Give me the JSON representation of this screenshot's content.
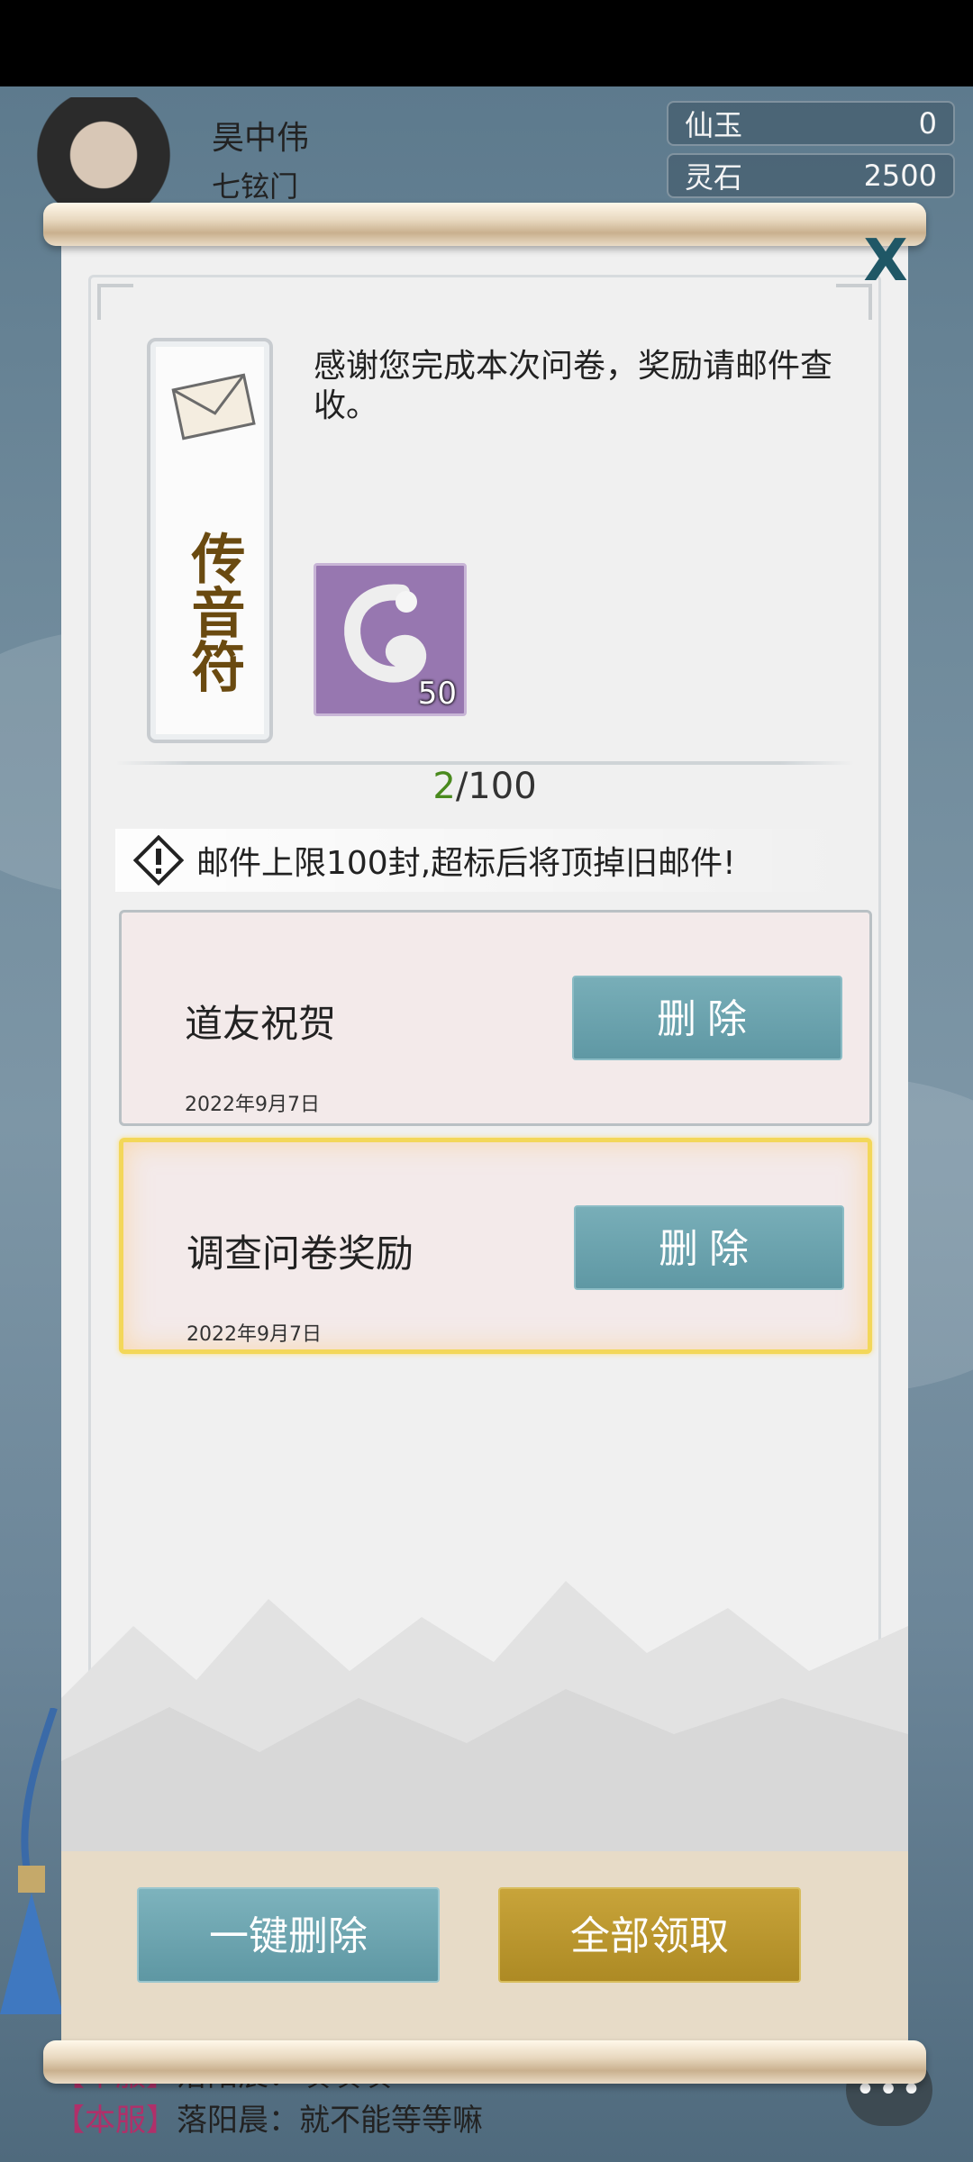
{
  "hud": {
    "player_name": "昊中伟",
    "sect": "七铉门",
    "resources": [
      {
        "label": "仙玉",
        "value": "0"
      },
      {
        "label": "灵石",
        "value": "2500"
      }
    ]
  },
  "dialog": {
    "close_label": "X",
    "talisman_title": "传音符",
    "message": "感谢您完成本次问卷，奖励请邮件查收。",
    "reward": {
      "count": "50",
      "icon": "silver-dragon-item-icon"
    },
    "mail_count": {
      "current": "2",
      "max": "/100"
    },
    "warning": "邮件上限100封,超标后将顶掉旧邮件!",
    "mails": [
      {
        "title": "道友祝贺",
        "date": "2022年9月7日",
        "delete_label": "删除",
        "selected": false
      },
      {
        "title": "调查问卷奖励",
        "date": "2022年9月7日",
        "delete_label": "删除",
        "selected": true
      }
    ],
    "delete_all_label": "一键删除",
    "claim_all_label": "全部领取"
  },
  "chat": {
    "lines": [
      {
        "tag": "【本服】",
        "text": "落阳晨：嘖嘖嘖"
      },
      {
        "tag": "【本服】",
        "text": "落阳晨：就不能等等嘛"
      }
    ],
    "button_label": "•••"
  },
  "colors": {
    "delete_button": "#6aa3ae",
    "claim_button": "#bb962f",
    "selected_border": "#f3d759",
    "count_current": "#4a8a1e"
  }
}
